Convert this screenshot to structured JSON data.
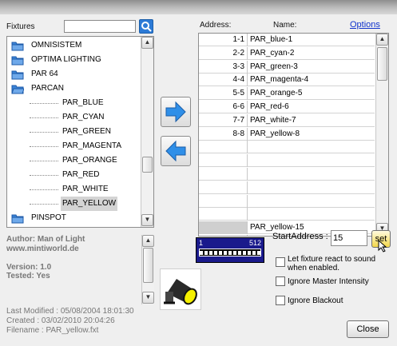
{
  "fixtures_label": "Fixtures",
  "search": {
    "value": ""
  },
  "tree": [
    {
      "type": "folder",
      "label": "OMNISISTEM"
    },
    {
      "type": "folder",
      "label": "OPTIMA LIGHTING"
    },
    {
      "type": "folder",
      "label": "PAR 64"
    },
    {
      "type": "folder-open",
      "label": "PARCAN"
    },
    {
      "type": "leaf",
      "label": "PAR_BLUE"
    },
    {
      "type": "leaf",
      "label": "PAR_CYAN"
    },
    {
      "type": "leaf",
      "label": "PAR_GREEN"
    },
    {
      "type": "leaf",
      "label": "PAR_MAGENTA"
    },
    {
      "type": "leaf",
      "label": "PAR_ORANGE"
    },
    {
      "type": "leaf",
      "label": "PAR_RED"
    },
    {
      "type": "leaf",
      "label": "PAR_WHITE"
    },
    {
      "type": "leaf-selected",
      "label": "PAR_YELLOW"
    },
    {
      "type": "folder",
      "label": "PINSPOT"
    }
  ],
  "info": {
    "author": "Author: Man of Light",
    "website": "www.mintiworld.de",
    "version": "Version: 1.0",
    "tested": "Tested: Yes",
    "last_modified": "Last Modified : 05/08/2004 18:01:30",
    "created": "Created : 03/02/2010 20:04:26",
    "filename": "Filename : PAR_yellow.fxt"
  },
  "grid": {
    "address_header": "Address:",
    "name_header": "Name:",
    "options_link": "Options",
    "rows": [
      {
        "addr": "1-1",
        "name": "PAR_blue-1"
      },
      {
        "addr": "2-2",
        "name": "PAR_cyan-2"
      },
      {
        "addr": "3-3",
        "name": "PAR_green-3"
      },
      {
        "addr": "4-4",
        "name": "PAR_magenta-4"
      },
      {
        "addr": "5-5",
        "name": "PAR_orange-5"
      },
      {
        "addr": "6-6",
        "name": "PAR_red-6"
      },
      {
        "addr": "7-7",
        "name": "PAR_white-7"
      },
      {
        "addr": "8-8",
        "name": "PAR_yellow-8"
      },
      {
        "addr": "",
        "name": ""
      },
      {
        "addr": "",
        "name": ""
      },
      {
        "addr": "",
        "name": ""
      },
      {
        "addr": "",
        "name": ""
      },
      {
        "addr": "",
        "name": ""
      },
      {
        "addr": "",
        "name": ""
      },
      {
        "addr": "",
        "name": "PAR_yellow-15"
      },
      {
        "addr": "",
        "name": ""
      }
    ]
  },
  "dmx": {
    "start": "1",
    "end": "512"
  },
  "start_address": {
    "label": "StartAddress :",
    "value": "15",
    "set_label": "set"
  },
  "options": {
    "sound": "Let fixture react to sound when enabled.",
    "ignore_master": "Ignore Master Intensity",
    "ignore_blackout": "Ignore Blackout"
  },
  "close_label": "Close"
}
